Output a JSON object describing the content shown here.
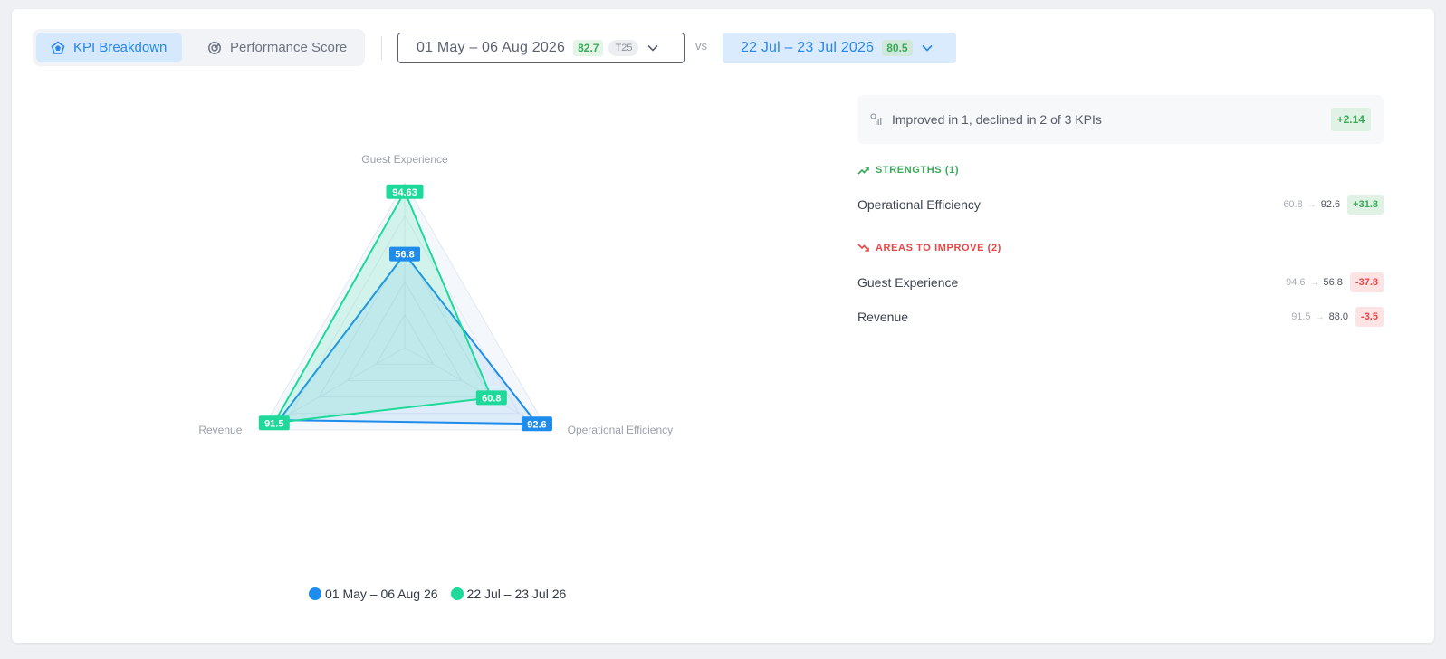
{
  "tabs": [
    {
      "label": "KPI Breakdown",
      "active": true,
      "icon": "pentagon-radar-icon"
    },
    {
      "label": "Performance Score",
      "active": false,
      "icon": "gauge-icon"
    }
  ],
  "period_a": {
    "label": "01 May – 06 Aug 2026",
    "score": "82.7",
    "tag": "T25"
  },
  "vs_label": "vs",
  "period_b": {
    "label": "22 Jul – 23 Jul 2026",
    "score": "80.5"
  },
  "summary": {
    "text": "Improved in 1, declined in 2 of 3 KPIs",
    "delta": "+2.14"
  },
  "strengths": {
    "heading": "STRENGTHS (1)",
    "items": [
      {
        "name": "Operational Efficiency",
        "from": "60.8",
        "to": "92.6",
        "change": "+31.8"
      }
    ]
  },
  "improve": {
    "heading": "AREAS TO IMPROVE (2)",
    "items": [
      {
        "name": "Guest Experience",
        "from": "94.6",
        "to": "56.8",
        "change": "-37.8"
      },
      {
        "name": "Revenue",
        "from": "91.5",
        "to": "88.0",
        "change": "-3.5"
      }
    ]
  },
  "colors": {
    "accent_blue": "#1f8ceb",
    "accent_green": "#1ed99a",
    "positive": "#3aa95a",
    "negative": "#e84545"
  },
  "chart_data": {
    "type": "radar",
    "axes": [
      "Guest Experience",
      "Operational Efficiency",
      "Revenue"
    ],
    "range": [
      0,
      100
    ],
    "series": [
      {
        "name": "01 May – 06 Aug 26",
        "values": [
          56.8,
          92.6,
          88.0
        ],
        "labels": [
          "56.8",
          "92.6",
          ""
        ],
        "color": "#1f8ceb"
      },
      {
        "name": "22 Jul – 23 Jul 26",
        "values": [
          94.63,
          60.8,
          91.5
        ],
        "labels": [
          "94.63",
          "60.8",
          "91.5"
        ],
        "color": "#1ed99a"
      }
    ]
  }
}
